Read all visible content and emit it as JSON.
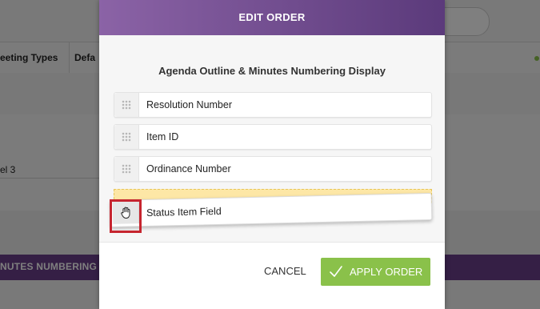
{
  "background": {
    "tabs": [
      "eeting Types",
      "Defa"
    ],
    "level_text": "el 3",
    "section_banner": "NUTES NUMBERING D"
  },
  "modal": {
    "title": "EDIT ORDER",
    "subtitle": "Agenda Outline & Minutes Numbering Display",
    "items": [
      {
        "label": "Resolution Number",
        "icon": "drag-grip-icon"
      },
      {
        "label": "Item ID",
        "icon": "drag-grip-icon"
      },
      {
        "label": "Ordinance Number",
        "icon": "drag-grip-icon"
      }
    ],
    "dragging_item": {
      "label": "Status Item Field",
      "icon": "hand-grab-icon"
    },
    "cancel_label": "CANCEL",
    "apply_label": "APPLY ORDER"
  },
  "colors": {
    "header_start": "#8b63a6",
    "header_end": "#5b3a7b",
    "apply_button": "#8ac14a",
    "drop_placeholder": "#fde7a6",
    "highlight_box": "#c6252f"
  }
}
